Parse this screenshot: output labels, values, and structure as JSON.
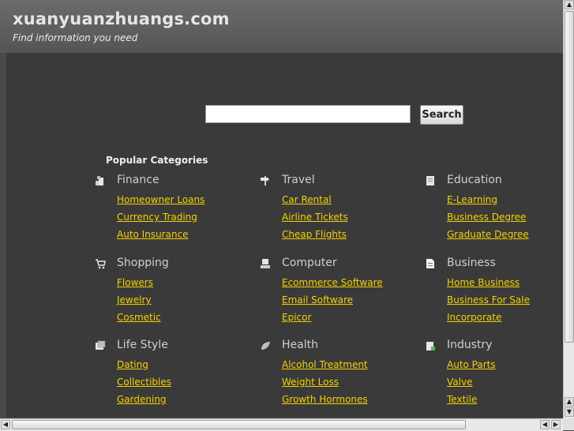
{
  "header": {
    "title": "xuanyuanzhuangs.com",
    "tagline": "Find information you need"
  },
  "search": {
    "value": "",
    "placeholder": "",
    "button_label": "Search"
  },
  "popular_heading": "Popular Categories",
  "categories": [
    {
      "title": "Finance",
      "icon": "finance-icon",
      "links": [
        "Homeowner Loans",
        "Currency Trading",
        "Auto Insurance"
      ]
    },
    {
      "title": "Travel",
      "icon": "signpost-icon",
      "links": [
        "Car Rental",
        "Airline Tickets",
        "Cheap Flights"
      ]
    },
    {
      "title": "Education",
      "icon": "book-icon",
      "links": [
        "E-Learning",
        "Business Degree",
        "Graduate Degree"
      ]
    },
    {
      "title": "Shopping",
      "icon": "cart-icon",
      "links": [
        "Flowers",
        "Jewelry",
        "Cosmetic"
      ]
    },
    {
      "title": "Computer",
      "icon": "computer-icon",
      "links": [
        "Ecommerce Software",
        "Email Software",
        "Epicor"
      ]
    },
    {
      "title": "Business",
      "icon": "document-icon",
      "links": [
        "Home Business",
        "Business For Sale",
        "Incorporate"
      ]
    },
    {
      "title": "Life Style",
      "icon": "lifestyle-icon",
      "links": [
        "Dating",
        "Collectibles",
        "Gardening"
      ]
    },
    {
      "title": "Health",
      "icon": "leaf-icon",
      "links": [
        "Alcohol Treatment",
        "Weight Loss",
        "Growth Hormones"
      ]
    },
    {
      "title": "Industry",
      "icon": "industry-icon",
      "links": [
        "Auto Parts",
        "Valve",
        "Textile"
      ]
    }
  ],
  "colors": {
    "link": "#f5d100",
    "background": "#3a3a3a",
    "header": "#5e5e5e"
  }
}
